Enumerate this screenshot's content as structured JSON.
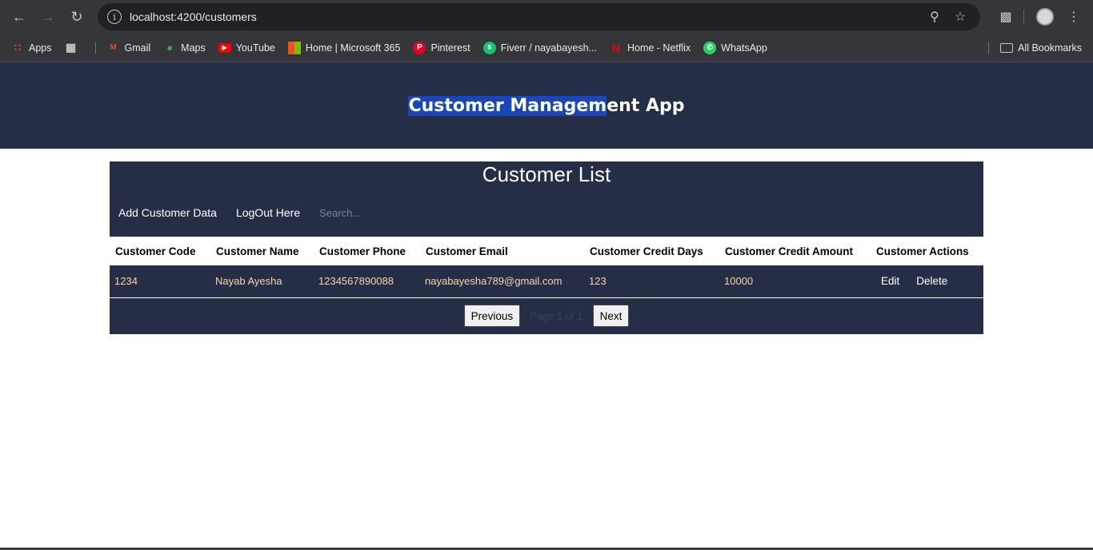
{
  "browser": {
    "url": "localhost:4200/customers",
    "bookmarks": [
      {
        "label": "Apps"
      },
      {
        "label": "Gmail"
      },
      {
        "label": "Maps"
      },
      {
        "label": "YouTube"
      },
      {
        "label": "Home | Microsoft 365"
      },
      {
        "label": "Pinterest"
      },
      {
        "label": "Fiverr / nayabayesh..."
      },
      {
        "label": "Home - Netflix"
      },
      {
        "label": "WhatsApp"
      }
    ],
    "all_bookmarks": "All Bookmarks"
  },
  "app": {
    "title_highlighted": "Customer Managem",
    "title_rest": "ent App"
  },
  "list": {
    "title": "Customer List",
    "add_label": "Add Customer Data",
    "logout_label": "LogOut Here",
    "search_placeholder": "Search..."
  },
  "table": {
    "headers": [
      "Customer Code",
      "Customer Name",
      "Customer Phone",
      "Customer Email",
      "Customer Credit Days",
      "Customer Credit Amount",
      "Customer Actions"
    ],
    "rows": [
      {
        "code": "1234",
        "name": "Nayab Ayesha",
        "phone": "1234567890088",
        "email": "nayabayesha789@gmail.com",
        "days": "123",
        "amount": "10000",
        "edit": "Edit",
        "delete": "Delete"
      }
    ]
  },
  "pager": {
    "prev": "Previous",
    "info": "Page 1 of 1",
    "next": "Next"
  },
  "colors": {
    "header_bg": "#262d47",
    "cell_text": "#f6d7a8",
    "title_highlight": "#1a47b8"
  }
}
